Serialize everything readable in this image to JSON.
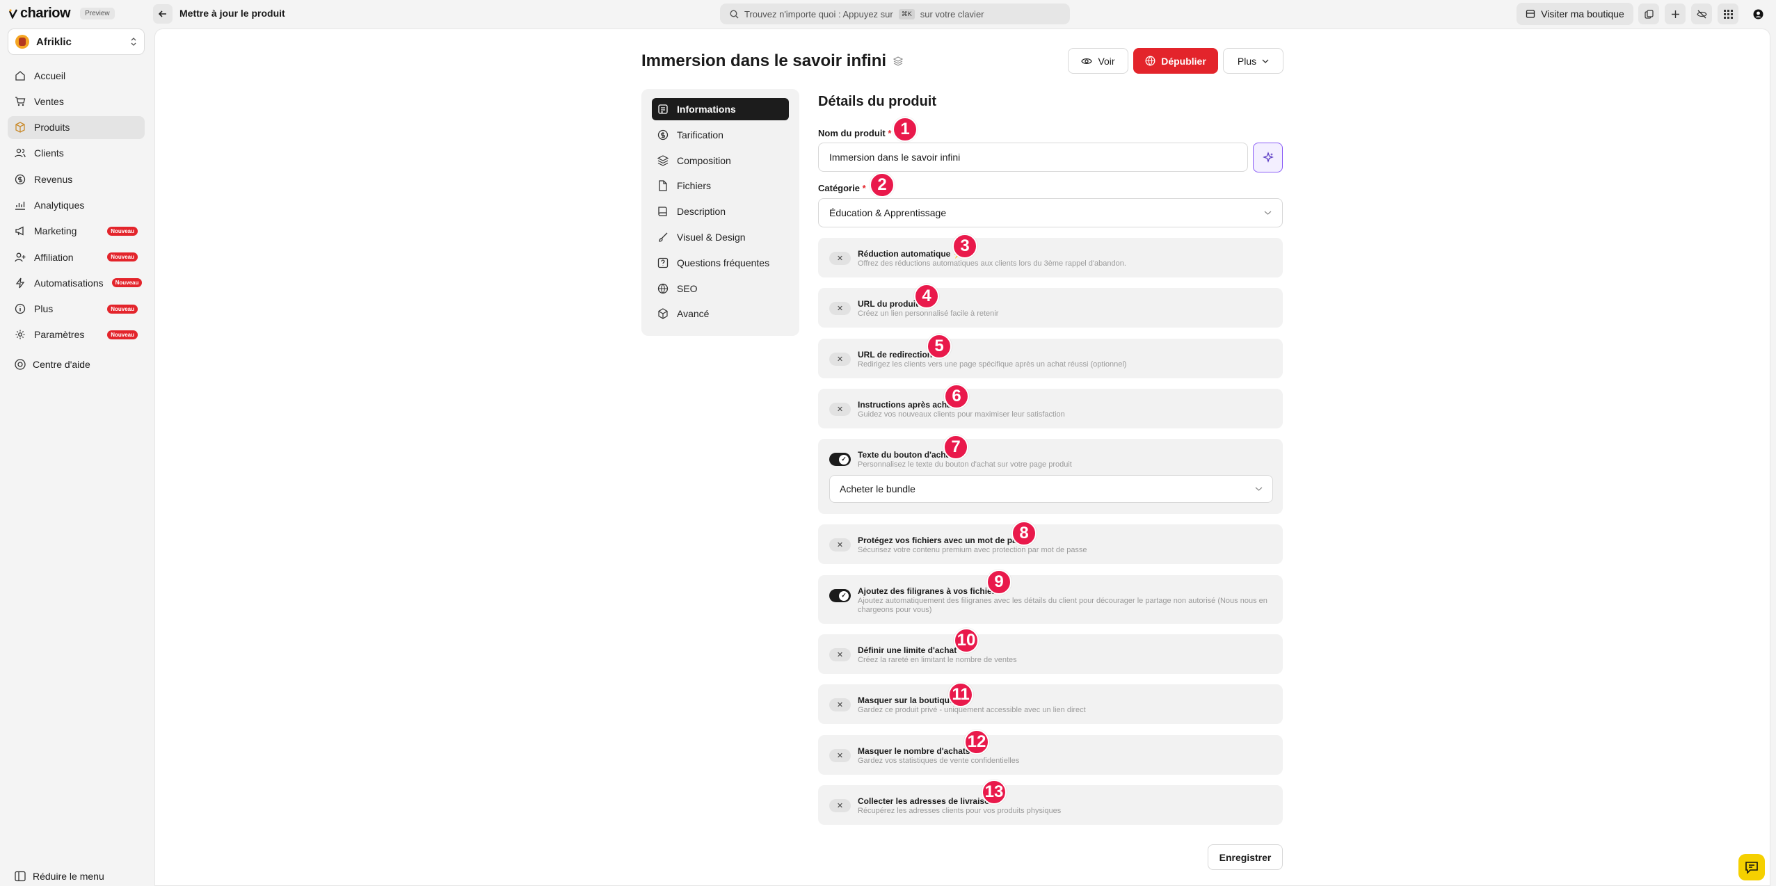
{
  "app": {
    "name": "chariow",
    "badge": "Preview"
  },
  "header": {
    "page_title": "Mettre à jour le produit",
    "search_text": "Trouvez n'importe quoi : Appuyez sur",
    "search_kbd": "⌘K",
    "search_suffix": "sur votre clavier",
    "visit_label": "Visiter ma boutique"
  },
  "shop": {
    "name": "Afriklic"
  },
  "sidebar": {
    "items": [
      {
        "label": "Accueil",
        "icon": "home-icon"
      },
      {
        "label": "Ventes",
        "icon": "cart-icon"
      },
      {
        "label": "Produits",
        "icon": "box-icon",
        "active": true
      },
      {
        "label": "Clients",
        "icon": "users-icon"
      },
      {
        "label": "Revenus",
        "icon": "coin-icon"
      },
      {
        "label": "Analytiques",
        "icon": "chart-icon"
      },
      {
        "label": "Marketing",
        "icon": "megaphone-icon",
        "badge": "Nouveau"
      },
      {
        "label": "Affiliation",
        "icon": "user-plus-icon",
        "badge": "Nouveau"
      },
      {
        "label": "Automatisations",
        "icon": "bolt-icon",
        "badge": "Nouveau"
      },
      {
        "label": "Plus",
        "icon": "info-icon",
        "badge": "Nouveau"
      },
      {
        "label": "Paramètres",
        "icon": "gear-icon",
        "badge": "Nouveau"
      }
    ],
    "help": "Centre d'aide",
    "reduce": "Réduire le menu"
  },
  "product": {
    "title": "Immersion dans le savoir infini"
  },
  "actions": {
    "voir": "Voir",
    "depublier": "Dépublier",
    "plus": "Plus",
    "save": "Enregistrer"
  },
  "tabs": [
    {
      "label": "Informations",
      "active": true
    },
    {
      "label": "Tarification"
    },
    {
      "label": "Composition"
    },
    {
      "label": "Fichiers"
    },
    {
      "label": "Description"
    },
    {
      "label": "Visuel & Design"
    },
    {
      "label": "Questions fréquentes"
    },
    {
      "label": "SEO"
    },
    {
      "label": "Avancé"
    }
  ],
  "form": {
    "section_title": "Détails du produit",
    "name_label": "Nom du produit",
    "name_value": "Immersion dans le savoir infini",
    "category_label": "Catégorie",
    "category_value": "Éducation & Apprentissage",
    "required_mark": "*",
    "button_text_value": "Acheter le bundle"
  },
  "options": [
    {
      "title": "Réduction automatique ⚡",
      "desc": "Offrez des réductions automatiques aux clients lors du 3ème rappel d'abandon.",
      "on": false,
      "num": "1"
    },
    {
      "title": "URL du produit",
      "desc": "Créez un lien personnalisé facile à retenir",
      "on": false
    },
    {
      "title": "URL de redirection",
      "desc": "Redirigez les clients vers une page spécifique après un achat réussi (optionnel)",
      "on": false
    },
    {
      "title": "Instructions après achat",
      "desc": "Guidez vos nouveaux clients pour maximiser leur satisfaction",
      "on": false
    },
    {
      "title": "Texte du bouton d'achat",
      "desc": "Personnalisez le texte du bouton d'achat sur votre page produit",
      "on": true
    },
    {
      "title": "Protégez vos fichiers avec un mot de passe",
      "desc": "Sécurisez votre contenu premium avec protection par mot de passe",
      "on": false
    },
    {
      "title": "Ajoutez des filigranes à vos fichiers",
      "desc": "Ajoutez automatiquement des filigranes avec les détails du client pour décourager le partage non autorisé (Nous nous en chargeons pour vous)",
      "on": true
    },
    {
      "title": "Définir une limite d'achat",
      "desc": "Créez la rareté en limitant le nombre de ventes",
      "on": false
    },
    {
      "title": "Masquer sur la boutique",
      "desc": "Gardez ce produit privé - uniquement accessible avec un lien direct",
      "on": false
    },
    {
      "title": "Masquer le nombre d'achats",
      "desc": "Gardez vos statistiques de vente confidentielles",
      "on": false
    },
    {
      "title": "Collecter les adresses de livraison",
      "desc": "Récupérez les adresses clients pour vos produits physiques",
      "on": false
    }
  ],
  "markers": [
    "1",
    "2",
    "3",
    "4",
    "5",
    "6",
    "7",
    "8",
    "9",
    "10",
    "11",
    "12",
    "13"
  ],
  "colors": {
    "accent": "#e3242b",
    "marker": "#e9194b",
    "ai": "#8a5cf6"
  }
}
